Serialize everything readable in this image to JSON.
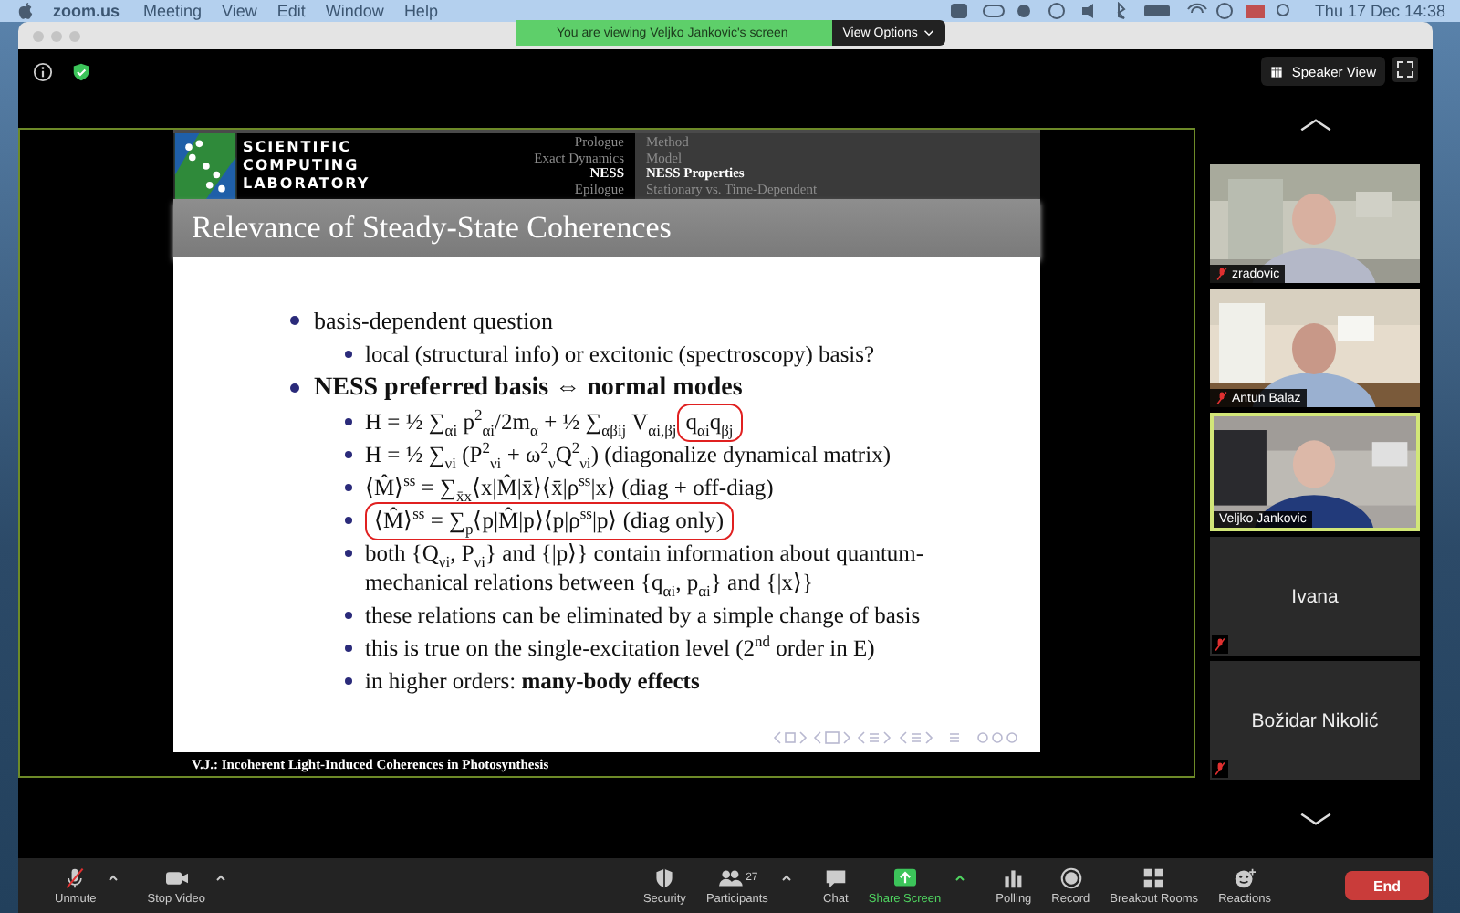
{
  "menu_bar": {
    "app": "zoom.us",
    "items": [
      "Meeting",
      "View",
      "Edit",
      "Window",
      "Help"
    ],
    "clock": "Thu 17 Dec  14:38"
  },
  "banner": {
    "text": "You are viewing Veljko Jankovic's screen",
    "options": "View Options"
  },
  "view_button": "Speaker View",
  "slide": {
    "logo_lines": [
      "SCIENTIFIC",
      "COMPUTING",
      "LABORATORY"
    ],
    "sections": [
      {
        "label": "Prologue",
        "selected": false
      },
      {
        "label": "Exact Dynamics",
        "selected": false
      },
      {
        "label": "NESS",
        "selected": true
      },
      {
        "label": "Epilogue",
        "selected": false
      }
    ],
    "subsections": [
      {
        "label": "Method",
        "selected": false
      },
      {
        "label": "Model",
        "selected": false
      },
      {
        "label": "NESS Properties",
        "selected": true
      },
      {
        "label": "Stationary vs. Time-Dependent",
        "selected": false
      }
    ],
    "title": "Relevance of Steady-State Coherences",
    "bullets": [
      {
        "text": "basis-dependent question",
        "bold": false,
        "children": [
          {
            "text": "local (structural info) or excitonic (spectroscopy) basis?"
          }
        ]
      },
      {
        "text": "NESS preferred basis ⇔ normal modes",
        "bold": true,
        "children": [
          {
            "text": "H = ½ ∑$_{αi}$ p$^{2}$$_{αi}$/2m$_{α}$ + ½ ∑$_{αβij}$ V$_{αi,βj}$",
            "circled": "q$_{αi}$q$_{βj}$"
          },
          {
            "text": "H = ½ ∑$_{νi}$ (P$^{2}$$_{νi}$ + ω$^{2}$$_{ν}$Q$^{2}$$_{νi}$) (diagonalize dynamical matrix)"
          },
          {
            "text": "⟨M̂⟩$^{ss}$ = ∑$_{x̄x}$⟨x|M̂|x̄⟩⟨x̄|ρ$^{ss}$|x⟩ (diag + off-diag)"
          },
          {
            "circled": "⟨M̂⟩$^{ss}$ = ∑$_{p}$⟨p|M̂|p⟩⟨p|ρ$^{ss}$|p⟩ (diag only)"
          },
          {
            "text": "both {Q$_{νi}$, P$_{νi}$} and {|p⟩} contain information about quantum-mechanical relations between {q$_{αi}$, p$_{αi}$} and {|x⟩}"
          },
          {
            "text": "these relations can be eliminated by a simple change of basis"
          },
          {
            "text": "this is true on the single-excitation level (2$^{nd}$ order in E)"
          },
          {
            "text": "in higher orders: **many-body effects**"
          }
        ]
      }
    ],
    "footer": "V.J.: Incoherent Light-Induced Coherences in Photosynthesis"
  },
  "participants": [
    {
      "name": "zradovic",
      "kind": "video",
      "muted": true,
      "speaking": false
    },
    {
      "name": "Antun Balaz",
      "kind": "video",
      "muted": true,
      "speaking": false
    },
    {
      "name": "Veljko Jankovic",
      "kind": "video",
      "muted": false,
      "speaking": true
    },
    {
      "name": "Ivana",
      "kind": "name",
      "muted": true,
      "speaking": false
    },
    {
      "name": "Božidar Nikolić",
      "kind": "name",
      "muted": true,
      "speaking": false
    }
  ],
  "toolbar": [
    {
      "kind": "mic",
      "label": "Unmute",
      "menu": true,
      "highlighted": false
    },
    {
      "kind": "camera",
      "label": "Stop Video",
      "menu": true,
      "highlighted": false
    },
    {
      "kind": "security",
      "label": "Security",
      "menu": false,
      "highlighted": false
    },
    {
      "kind": "participants",
      "label": "Participants",
      "count": "27",
      "menu": true,
      "highlighted": false
    },
    {
      "kind": "chat",
      "label": "Chat",
      "menu": false,
      "highlighted": false
    },
    {
      "kind": "share",
      "label": "Share Screen",
      "menu": true,
      "highlighted": true
    },
    {
      "kind": "polling",
      "label": "Polling",
      "menu": false,
      "highlighted": false
    },
    {
      "kind": "record",
      "label": "Record",
      "menu": false,
      "highlighted": false
    },
    {
      "kind": "breakout",
      "label": "Breakout Rooms",
      "menu": false,
      "highlighted": false
    },
    {
      "kind": "reactions",
      "label": "Reactions",
      "menu": false,
      "highlighted": false
    }
  ],
  "end_button": "End"
}
